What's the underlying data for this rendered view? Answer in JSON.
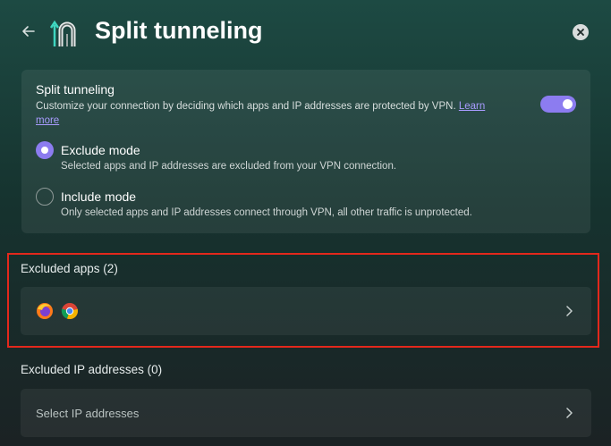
{
  "header": {
    "title": "Split tunneling"
  },
  "card": {
    "title": "Split tunneling",
    "description": "Customize your connection by deciding which apps and IP addresses are protected by VPN.",
    "learn_more": "Learn more",
    "toggle_on": true,
    "options": [
      {
        "label": "Exclude mode",
        "description": "Selected apps and IP addresses are excluded from your VPN connection.",
        "selected": true
      },
      {
        "label": "Include mode",
        "description": "Only selected apps and IP addresses connect through VPN, all other traffic is unprotected.",
        "selected": false
      }
    ]
  },
  "excluded_apps": {
    "label": "Excluded apps (2)",
    "apps": [
      "firefox-icon",
      "chrome-icon"
    ]
  },
  "excluded_ips": {
    "label": "Excluded IP addresses (0)",
    "placeholder": "Select IP addresses"
  },
  "colors": {
    "accent": "#8c7cf0",
    "highlight": "#e3281c",
    "link": "#a99cff"
  }
}
